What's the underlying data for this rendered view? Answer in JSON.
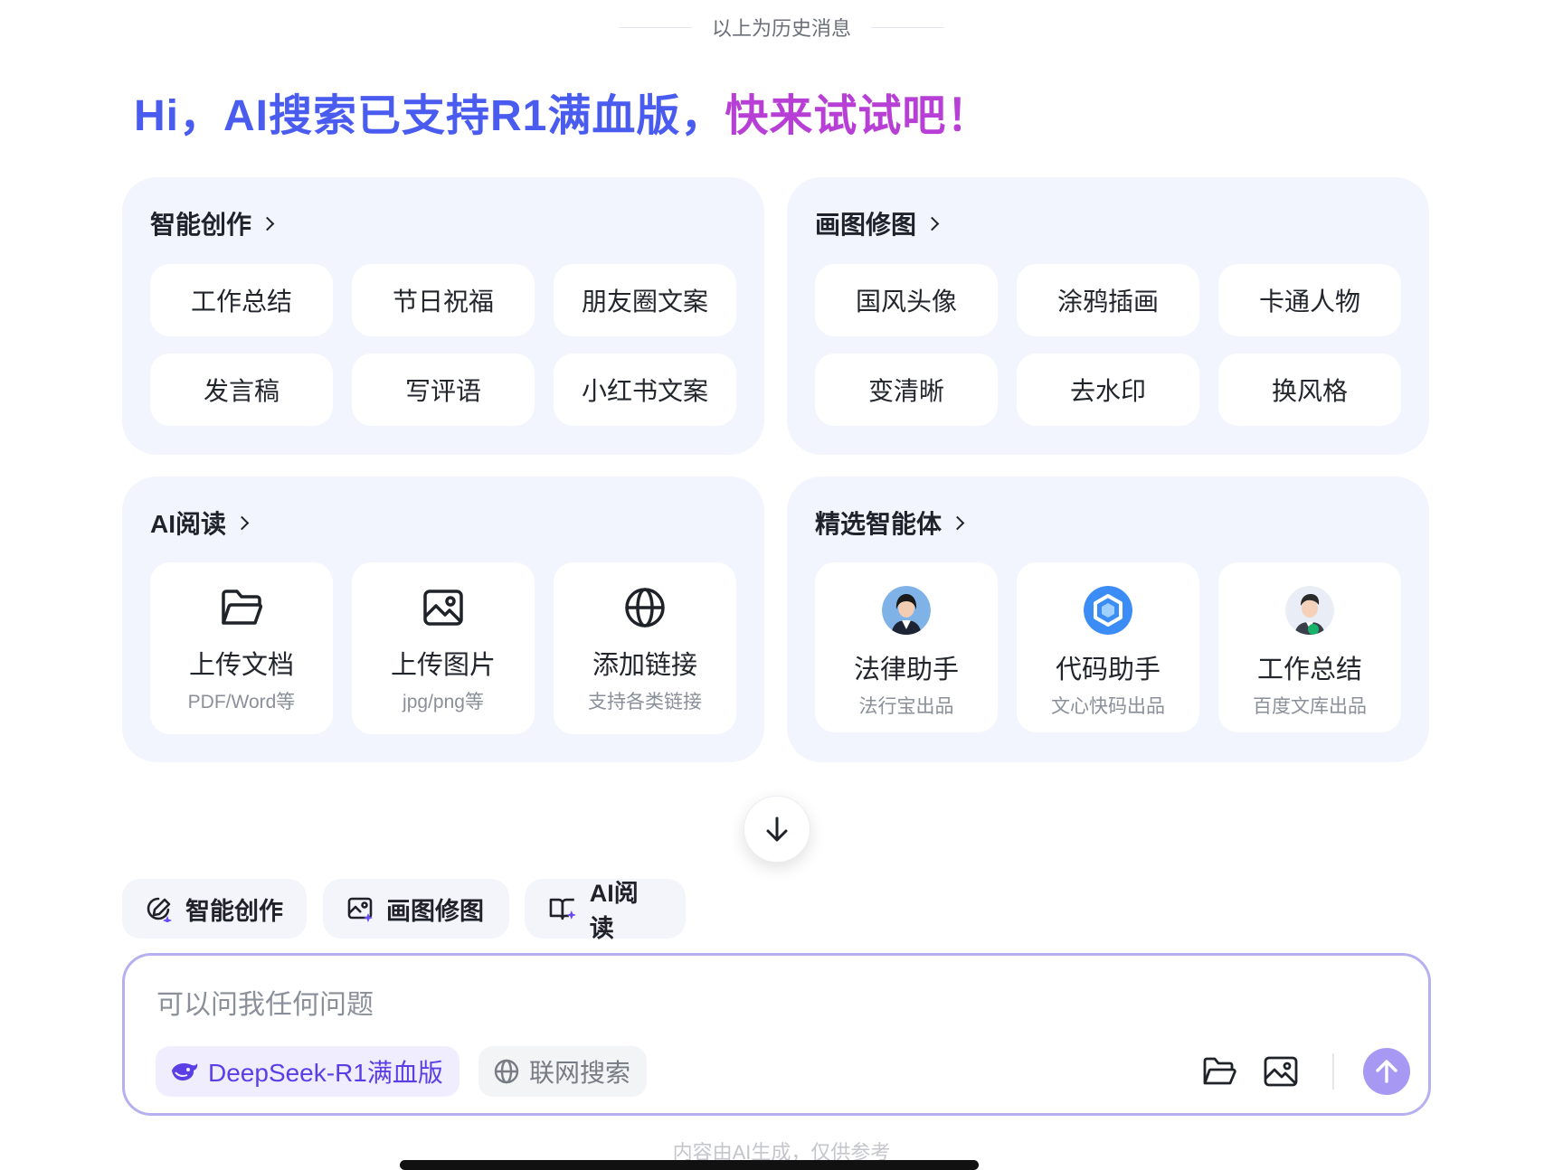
{
  "history_divider": "以上为历史消息",
  "greeting": {
    "part1": "Hi，AI搜索已支持R1满血版，",
    "part2": "快来试试吧！"
  },
  "colors": {
    "accent_blue": "#4a5cf0",
    "accent_purple": "#b83fd6",
    "card_bg": "#f3f5fe",
    "send_button": "#a799f3"
  },
  "cards": {
    "creation": {
      "title": "智能创作",
      "items": [
        "工作总结",
        "节日祝福",
        "朋友圈文案",
        "发言稿",
        "写评语",
        "小红书文案"
      ]
    },
    "image": {
      "title": "画图修图",
      "items": [
        "国风头像",
        "涂鸦插画",
        "卡通人物",
        "变清晰",
        "去水印",
        "换风格"
      ]
    },
    "reading": {
      "title": "AI阅读",
      "tiles": [
        {
          "icon": "folder-icon",
          "title": "上传文档",
          "sub": "PDF/Word等"
        },
        {
          "icon": "image-icon",
          "title": "上传图片",
          "sub": "jpg/png等"
        },
        {
          "icon": "globe-icon",
          "title": "添加链接",
          "sub": "支持各类链接"
        }
      ]
    },
    "agents": {
      "title": "精选智能体",
      "tiles": [
        {
          "icon": "lawyer-avatar",
          "title": "法律助手",
          "sub": "法行宝出品"
        },
        {
          "icon": "code-assistant-logo",
          "title": "代码助手",
          "sub": "文心快码出品"
        },
        {
          "icon": "cartoon-avatar",
          "title": "工作总结",
          "sub": "百度文库出品"
        }
      ]
    }
  },
  "quick_tabs": [
    {
      "icon": "pen-sparkle-icon",
      "label": "智能创作"
    },
    {
      "icon": "image-sparkle-icon",
      "label": "画图修图"
    },
    {
      "icon": "book-sparkle-icon",
      "label": "AI阅读"
    }
  ],
  "input": {
    "placeholder": "可以问我任何问题",
    "value": "",
    "model_chip": "DeepSeek-R1满血版",
    "web_chip": "联网搜索"
  },
  "disclaimer": "内容由AI生成，仅供参考"
}
